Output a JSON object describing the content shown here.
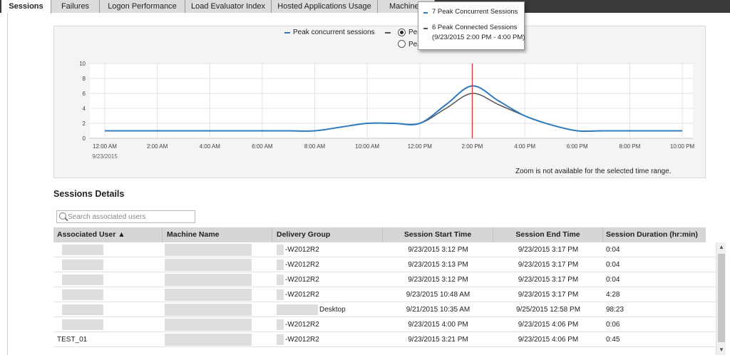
{
  "tabs": [
    {
      "label": "Sessions",
      "active": true
    },
    {
      "label": "Failures"
    },
    {
      "label": "Logon Performance"
    },
    {
      "label": "Load Evaluator Index"
    },
    {
      "label": "Hosted Applications Usage"
    },
    {
      "label": "Machine"
    }
  ],
  "legend": {
    "series1": "Peak concurrent sessions",
    "series2_prefix": "Pea",
    "radio1_prefix": "Pea",
    "radio2_prefix": "Pea"
  },
  "tooltip": {
    "line1": "7  Peak Concurrent Sessions",
    "line2": "6  Peak Connected Sessions",
    "line3": "(9/23/2015 2:00 PM - 4:00 PM)"
  },
  "chart_data": {
    "type": "line",
    "x": [
      "12:00 AM",
      "1:00 AM",
      "2:00 AM",
      "3:00 AM",
      "4:00 AM",
      "5:00 AM",
      "6:00 AM",
      "7:00 AM",
      "8:00 AM",
      "9:00 AM",
      "10:00 AM",
      "11:00 AM",
      "12:00 PM",
      "1:00 PM",
      "2:00 PM",
      "3:00 PM",
      "4:00 PM",
      "5:00 PM",
      "6:00 PM",
      "7:00 PM",
      "8:00 PM",
      "9:00 PM",
      "10:00 PM"
    ],
    "x_tick_labels": [
      "12:00 AM",
      "2:00 AM",
      "4:00 AM",
      "6:00 AM",
      "8:00 AM",
      "10:00 AM",
      "12:00 PM",
      "2:00 PM",
      "4:00 PM",
      "6:00 PM",
      "8:00 PM",
      "10:00 PM"
    ],
    "x_sublabel": "9/23/2015",
    "series": [
      {
        "name": "Peak concurrent sessions",
        "color": "#2f7bbf",
        "values": [
          1,
          1,
          1,
          1,
          1,
          1,
          1,
          1,
          1,
          1.5,
          2,
          2,
          2,
          4.5,
          7,
          5,
          3,
          1.8,
          1,
          1,
          1,
          1,
          1
        ]
      },
      {
        "color": "#555555",
        "values": [
          1,
          1,
          1,
          1,
          1,
          1,
          1,
          1,
          1,
          1.5,
          2,
          2,
          2,
          4,
          6,
          4.5,
          3,
          1.8,
          1,
          1,
          1,
          1,
          1
        ]
      }
    ],
    "y_ticks": [
      0,
      2,
      4,
      6,
      8,
      10
    ],
    "ylim": [
      0,
      10
    ],
    "highlight_x": "2:00 PM",
    "highlight_color": "#e03030",
    "grid": true,
    "note": "Zoom is not available for the selected time range."
  },
  "details": {
    "title": "Sessions Details",
    "search_placeholder": "Search associated users",
    "columns": [
      "Associated User ▲",
      "Machine Name",
      "Delivery Group",
      "Session Start Time",
      "Session End Time",
      "Session Duration (hr:min)"
    ],
    "rows": [
      {
        "user": "",
        "machine": "",
        "group": "-W2012R2",
        "start": "9/23/2015 3:12 PM",
        "end": "9/23/2015 3:17 PM",
        "duration": "0:04"
      },
      {
        "user": "",
        "machine": "",
        "group": "-W2012R2",
        "start": "9/23/2015 3:13 PM",
        "end": "9/23/2015 3:17 PM",
        "duration": "0:04"
      },
      {
        "user": "",
        "machine": "",
        "group": "-W2012R2",
        "start": "9/23/2015 3:12 PM",
        "end": "9/23/2015 3:17 PM",
        "duration": "0:04"
      },
      {
        "user": "",
        "machine": "",
        "group": "-W2012R2",
        "start": "9/23/2015 10:48 AM",
        "end": "9/23/2015 3:17 PM",
        "duration": "4:28"
      },
      {
        "user": "",
        "machine": "",
        "group": "Desktop",
        "start": "9/21/2015 10:35 AM",
        "end": "9/25/2015 12:58 PM",
        "duration": "98:23"
      },
      {
        "user": "",
        "machine": "",
        "group": "-W2012R2",
        "start": "9/23/2015 4:00 PM",
        "end": "9/23/2015 4:06 PM",
        "duration": "0:06"
      },
      {
        "user": "TEST_01",
        "machine": "",
        "group": "-W2012R2",
        "start": "9/23/2015 3:21 PM",
        "end": "9/23/2015 4:06 PM",
        "duration": "0:45"
      }
    ]
  },
  "colors": {
    "accent": "#2f7bbf",
    "series2": "#555555",
    "cursor": "#e03030"
  }
}
